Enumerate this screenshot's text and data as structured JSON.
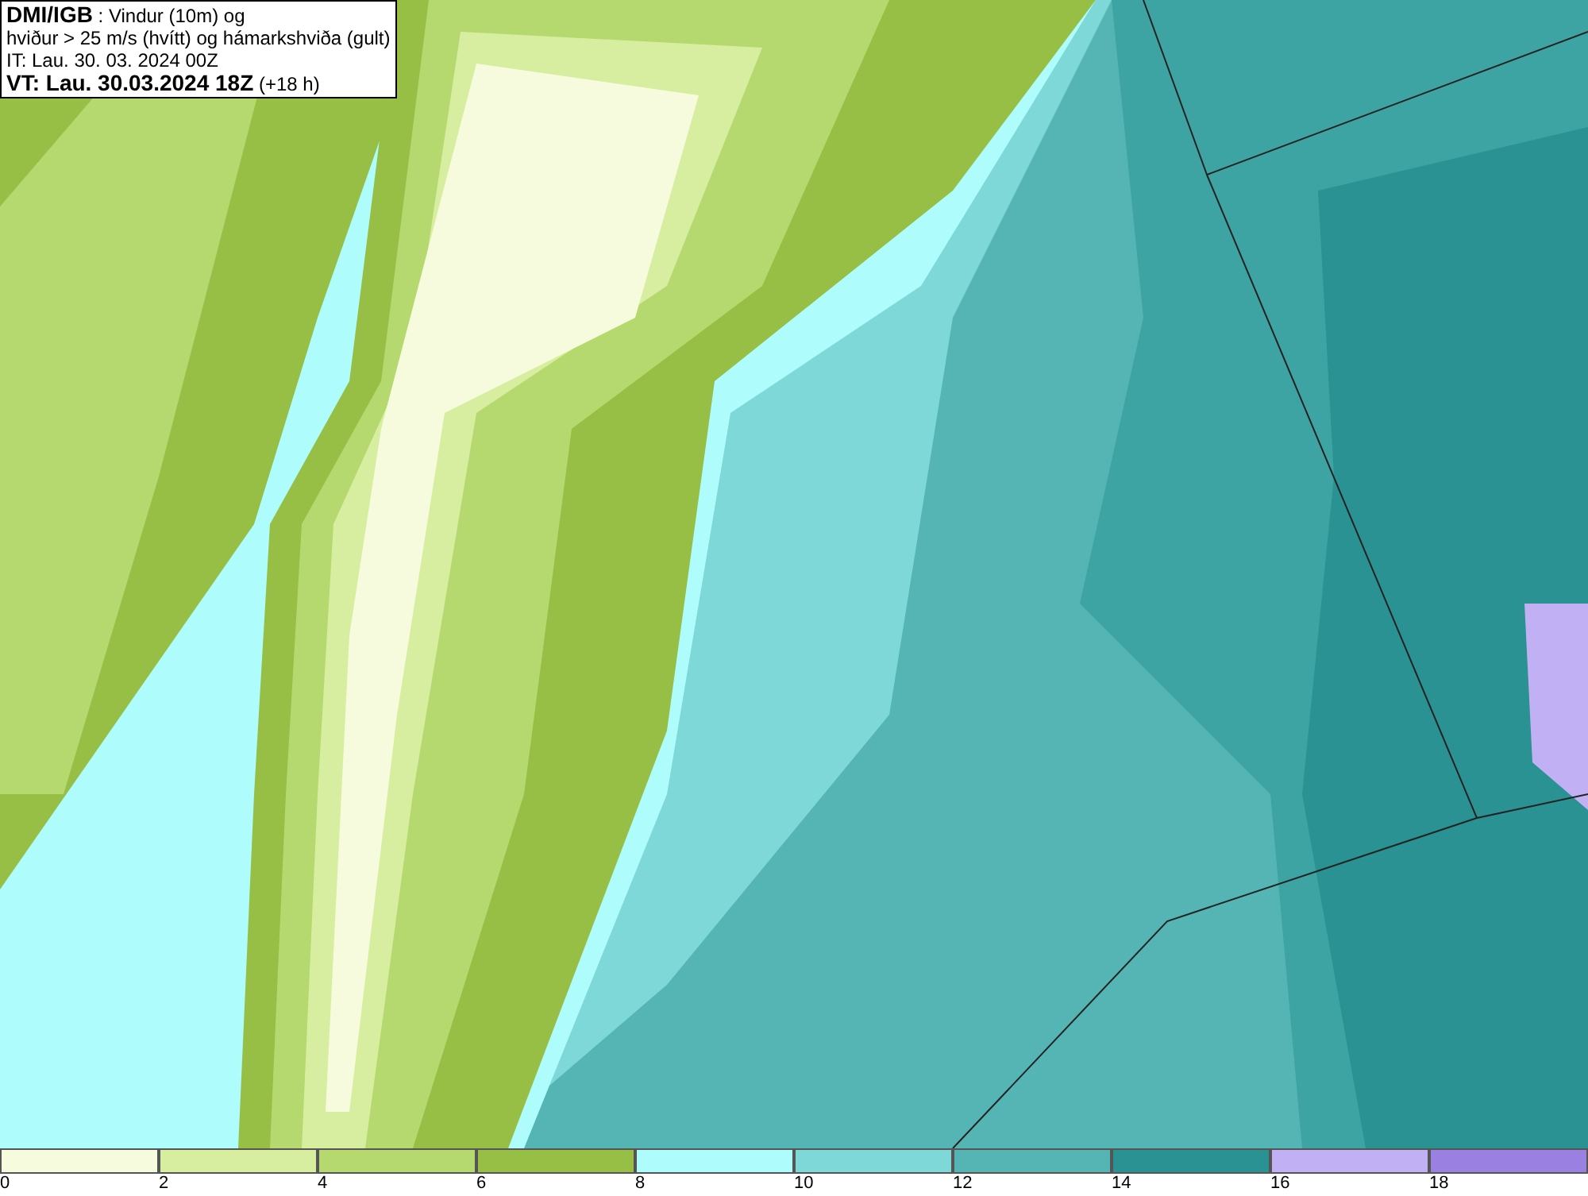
{
  "title_box": {
    "lines": [
      "**DMI/IGB** : Vindur (10m) og",
      "hviður > 25 m/s (hvítt) og hámarkshviða (gult)",
      "IT: Lau. 30. 03. 2024 00Z",
      "**VT: Lau. 30.03.2024 18Z** (+18 h)"
    ]
  },
  "legend": [
    {
      "label": "0",
      "color": "#f5fbdc"
    },
    {
      "label": "2",
      "color": "#d7eea0"
    },
    {
      "label": "4",
      "color": "#b5d96e"
    },
    {
      "label": "6",
      "color": "#97be45"
    },
    {
      "label": "8",
      "color": "#aefcfc"
    },
    {
      "label": "10",
      "color": "#7fd8d8"
    },
    {
      "label": "12",
      "color": "#55b5b5"
    },
    {
      "label": "14",
      "color": "#2a9292"
    },
    {
      "label": "16",
      "color": "#c2b0f5"
    },
    {
      "label": "18",
      "color": "#9a80e0"
    }
  ]
}
